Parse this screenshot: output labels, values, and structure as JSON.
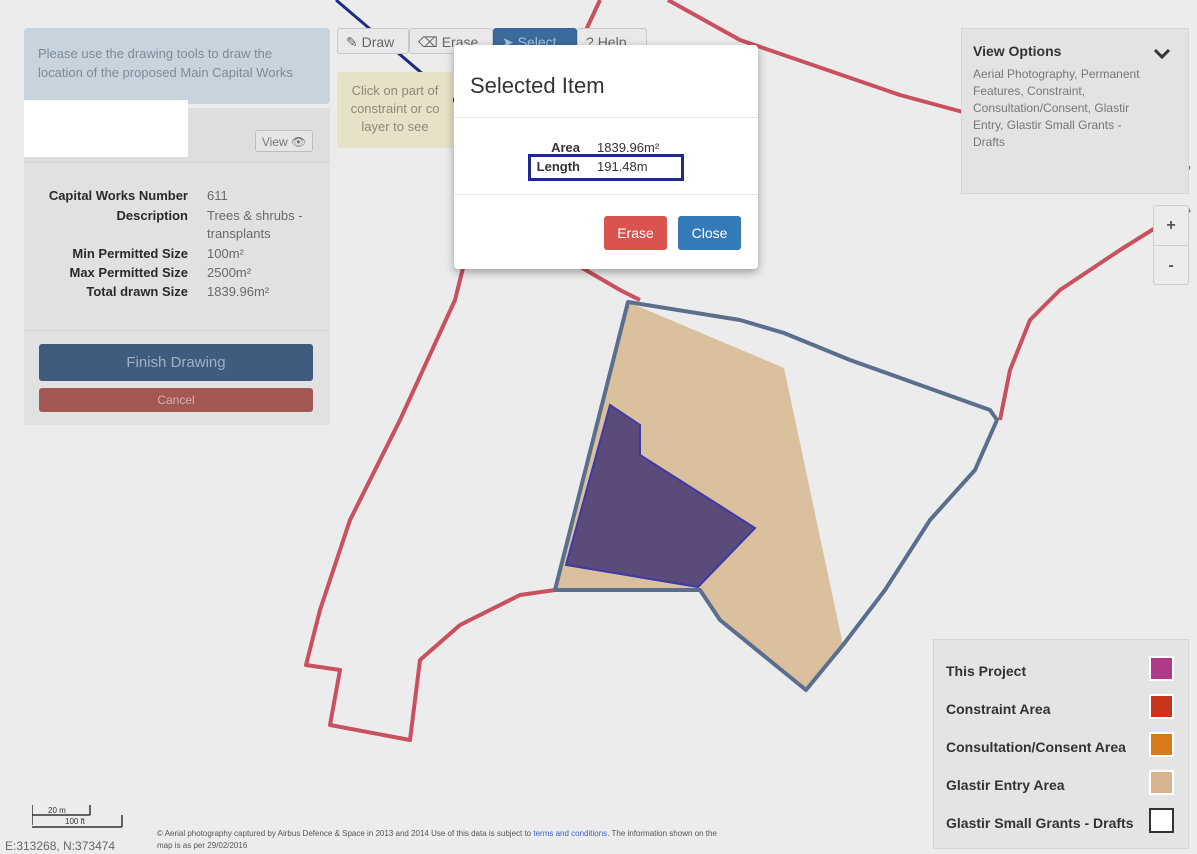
{
  "sidebar": {
    "instructions": "Please use the drawing tools to draw the location of the proposed Main Capital Works",
    "view_label": "View",
    "details": [
      {
        "label": "Capital Works Number",
        "value": "611"
      },
      {
        "label": "Description",
        "value": "Trees & shrubs - transplants"
      },
      {
        "label": "Min Permitted Size",
        "value": "100m²"
      },
      {
        "label": "Max Permitted Size",
        "value": "2500m²"
      },
      {
        "label": "Total drawn Size",
        "value": "1839.96m²"
      }
    ],
    "finish_label": "Finish Drawing",
    "cancel_label": "Cancel"
  },
  "toolbar": {
    "draw_label": "Draw",
    "erase_label": "Erase",
    "select_label": "Select",
    "help_label": "Help",
    "hint": "Click on part of constraint or co layer to see"
  },
  "modal": {
    "title": "Selected Item",
    "area_label": "Area",
    "area_value": "1839.96m²",
    "length_label": "Length",
    "length_value": "191.48m",
    "erase_label": "Erase",
    "close_label": "Close"
  },
  "view_options": {
    "title": "View Options",
    "layers": "Aerial Photography, Permanent Features, Constraint, Consultation/Consent, Glastir Entry, Glastir Small Grants - Drafts"
  },
  "zoom": {
    "in": "+",
    "out": "-"
  },
  "legend": {
    "items": [
      {
        "label": "This Project",
        "color": "#b03a8a"
      },
      {
        "label": "Constraint Area",
        "color": "#c9351a"
      },
      {
        "label": "Consultation/Consent Area",
        "color": "#d97a1a"
      },
      {
        "label": "Glastir Entry Area",
        "color": "#d7b48f"
      },
      {
        "label": "Glastir Small Grants - Drafts",
        "color": "#ffffff"
      }
    ]
  },
  "footer": {
    "scale_m": "20 m",
    "scale_ft": "100 ft",
    "coords": "E:313268, N:373474",
    "attribution_1": "© Aerial photography captured by Airbus Defence & Space in 2013 and 2014 Use of this data is subject to ",
    "attribution_link": "terms and conditions",
    "attribution_2": ". The information shown on the map is as per 29/02/2016"
  },
  "colors": {
    "boundary_red": "#c9505e",
    "draft_outline": "#5a6f8e",
    "consultation_fill": "#d8b88f",
    "project_fill": "#5b4b7b",
    "highlight_box": "#1f2a88"
  }
}
